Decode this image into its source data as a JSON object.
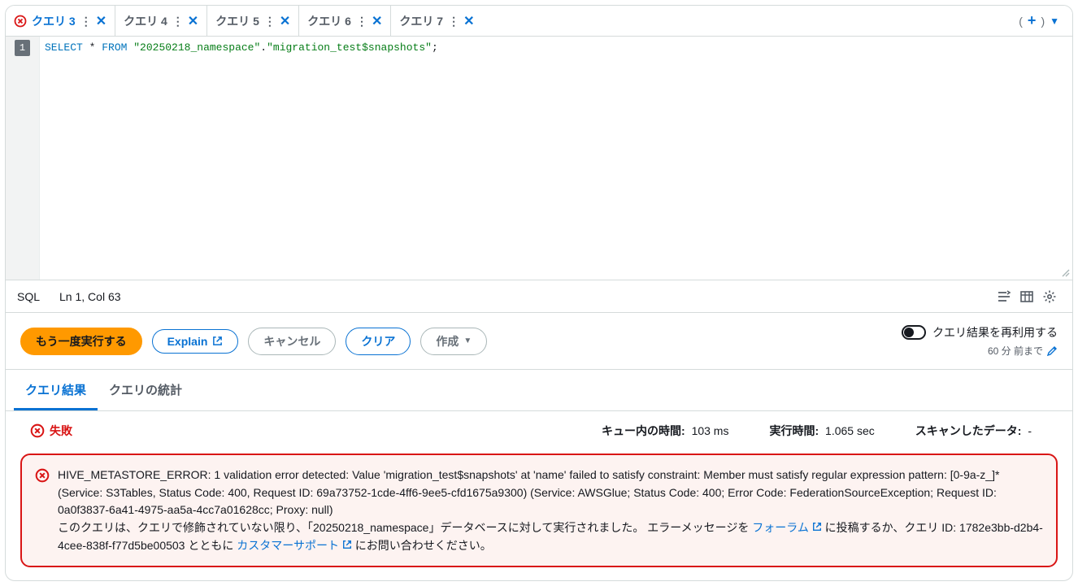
{
  "tabs": [
    {
      "label": "クエリ 3",
      "active": true,
      "error": true
    },
    {
      "label": "クエリ 4",
      "active": false,
      "error": false
    },
    {
      "label": "クエリ 5",
      "active": false,
      "error": false
    },
    {
      "label": "クエリ 6",
      "active": false,
      "error": false
    },
    {
      "label": "クエリ 7",
      "active": false,
      "error": false
    }
  ],
  "editor": {
    "line_number": "1",
    "sql_select": "SELECT",
    "sql_star": " * ",
    "sql_from": "FROM",
    "sql_sp": " ",
    "sql_str1": "\"20250218_namespace\"",
    "sql_dot": ".",
    "sql_str2": "\"migration_test$snapshots\"",
    "sql_semi": ";"
  },
  "status": {
    "lang": "SQL",
    "pos": "Ln 1, Col 63"
  },
  "actions": {
    "run": "もう一度実行する",
    "explain": "Explain",
    "cancel": "キャンセル",
    "clear": "クリア",
    "create": "作成",
    "reuse_label": "クエリ結果を再利用する",
    "reuse_sub": "60 分 前まで"
  },
  "result_tabs": {
    "results": "クエリ結果",
    "stats": "クエリの統計"
  },
  "result_header": {
    "status": "失敗",
    "queue_label": "キュー内の時間:",
    "queue_val": "103 ms",
    "runtime_label": "実行時間:",
    "runtime_val": "1.065 sec",
    "scanned_label": "スキャンしたデータ:",
    "scanned_val": "-"
  },
  "error": {
    "line1": "HIVE_METASTORE_ERROR: 1 validation error detected: Value 'migration_test$snapshots' at 'name' failed to satisfy constraint: Member must satisfy regular expression pattern: [0-9a-z_]* (Service: S3Tables, Status Code: 400, Request ID: 69a73752-1cde-4ff6-9ee5-cfd1675a9300) (Service: AWSGlue; Status Code: 400; Error Code: FederationSourceException; Request ID: 0a0f3837-6a41-4975-aa5a-4cc7a01628cc; Proxy: null)",
    "line2_a": "このクエリは、クエリで修飾されていない限り、「20250218_namespace」データベースに対して実行されました。 エラーメッセージを ",
    "line2_forum": "フォーラム",
    "line2_b": " に投稿するか、クエリ ID: 1782e3bb-d2b4-4cee-838f-f77d5be00503 とともに ",
    "line2_support": "カスタマーサポート",
    "line2_c": " にお問い合わせください。"
  }
}
